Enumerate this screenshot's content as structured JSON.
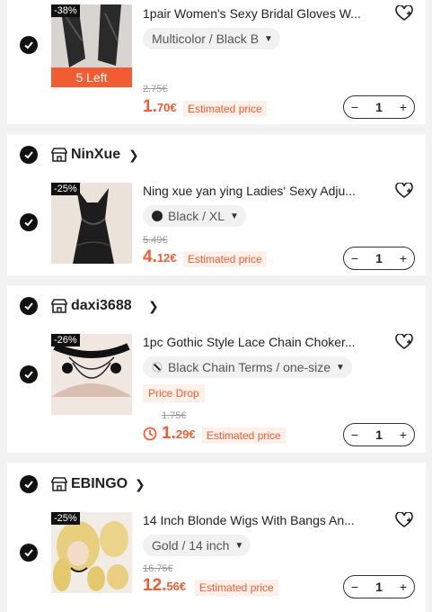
{
  "items": [
    {
      "discount": "-38%",
      "stock_banner": "5 Left",
      "title": "1pair Women's Sexy Bridal Gloves W...",
      "variant": "Multicolor / Black B",
      "original_price": "2.75€",
      "price_int": "1.",
      "price_dec": "70€",
      "estimated_label": "Estimated price",
      "quantity": "1"
    },
    {
      "store": "NinXue",
      "discount": "-25%",
      "title": "Ning xue yan ying Ladies' Sexy Adju...",
      "variant": "Black / XL",
      "original_price": "5.49€",
      "price_int": "4.",
      "price_dec": "12€",
      "estimated_label": "Estimated price",
      "quantity": "1"
    },
    {
      "store": "daxi3688",
      "discount": "-26%",
      "title": "1pc Gothic Style Lace Chain Choker...",
      "variant": "Black Chain Terms / one-size",
      "tag": "Price Drop",
      "original_price": "1.75€",
      "price_int": "1.",
      "price_dec": "29€",
      "estimated_label": "Estimated price",
      "quantity": "1"
    },
    {
      "store": "EBINGO",
      "discount": "-25%",
      "title": "14 Inch Blonde Wigs With Bangs An...",
      "variant": "Gold / 14 inch",
      "original_price": "16.75€",
      "price_int": "12.",
      "price_dec": "56€",
      "estimated_label": "Estimated price",
      "quantity": "1"
    }
  ],
  "icons": {
    "check": "checkmark-icon",
    "store": "store-icon",
    "wishlist": "heart-plus-icon",
    "clock": "clock-icon"
  },
  "colors": {
    "accent": "#f25c32",
    "check": "#111111",
    "background": "#f2f2f2"
  }
}
